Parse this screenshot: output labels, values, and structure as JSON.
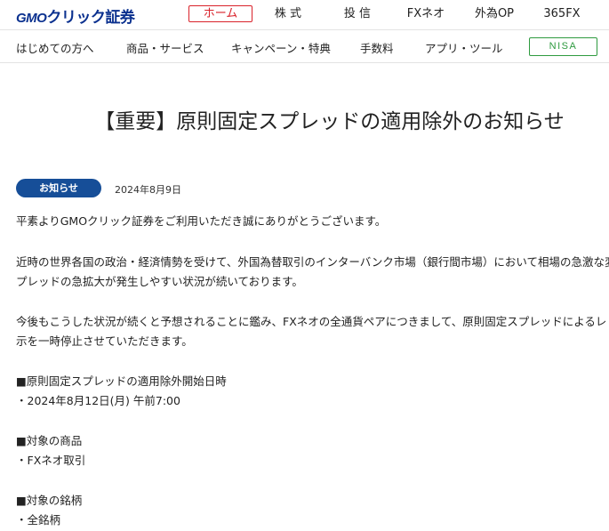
{
  "header": {
    "logo_text_gmo": "GMO",
    "logo_text_rest": "クリック証券",
    "nav": [
      {
        "label": "ホーム",
        "active": true
      },
      {
        "label": "株 式",
        "active": false
      },
      {
        "label": "投 信",
        "active": false
      },
      {
        "label": "FXネオ",
        "active": false
      },
      {
        "label": "外為OP",
        "active": false
      },
      {
        "label": "365FX",
        "active": false
      }
    ]
  },
  "subnav": {
    "items": [
      "はじめての方へ",
      "商品・サービス",
      "キャンペーン・特典",
      "手数料",
      "アプリ・ツール"
    ],
    "nisa_label": "NISA"
  },
  "article": {
    "title": "【重要】原則固定スプレッドの適用除外のお知らせ",
    "category": "お知らせ",
    "date": "2024年8月9日",
    "lines": [
      "平素よりGMOクリック証券をご利用いただき誠にありがとうございます。",
      "近時の世界各国の政治・経済情勢を受けて、外国為替取引のインターバンク市場（銀行間市場）において相場の急激な変",
      "プレッドの急拡大が発生しやすい状況が続いております。",
      "今後もこうした状況が続くと予想されることに鑑み、FXネオの全通貨ペアにつきまして、原則固定スプレッドによるレ",
      "示を一時停止させていただきます。",
      "■原則固定スプレッドの適用除外開始日時",
      "・2024年8月12日(月) 午前7:00",
      "■対象の商品",
      "・FXネオ取引",
      "■対象の銘柄",
      "・全銘柄"
    ]
  },
  "colors": {
    "brand_blue": "#0b318f",
    "active_red": "#d9222a",
    "badge_blue": "#164e98",
    "nisa_green": "#2e9a3f"
  }
}
